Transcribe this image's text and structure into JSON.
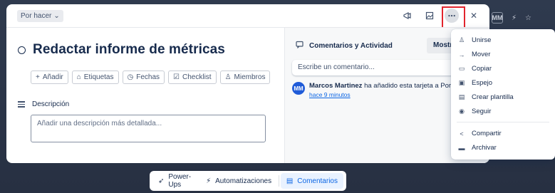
{
  "card": {
    "list_chip": "Por hacer",
    "title": "Redactar informe de métricas",
    "actions": [
      "Añadir",
      "Etiquetas",
      "Fechas",
      "Checklist",
      "Miembros"
    ],
    "description_heading": "Descripción",
    "description_placeholder": "Añadir una descripción más detallada..."
  },
  "activity_panel": {
    "heading": "Comentarios y Actividad",
    "show_button": "Mostrar",
    "comment_placeholder": "Escribe un comentario...",
    "entry": {
      "avatar_initials": "MM",
      "author": "Marcos Martinez",
      "text": "ha añadido esta tarjeta a Por hace",
      "time": "hace 9 minutos"
    }
  },
  "menu": {
    "items": [
      {
        "label": "Unirse",
        "icon": "user-plus-icon"
      },
      {
        "label": "Mover",
        "icon": "arrow-right-icon"
      },
      {
        "label": "Copiar",
        "icon": "copy-icon"
      },
      {
        "label": "Espejo",
        "icon": "mirror-icon"
      },
      {
        "label": "Crear plantilla",
        "icon": "template-icon"
      },
      {
        "label": "Seguir",
        "icon": "eye-icon"
      },
      {
        "label": "Compartir",
        "icon": "share-icon"
      },
      {
        "label": "Archivar",
        "icon": "archive-icon"
      }
    ]
  },
  "bottom_bar": {
    "items": [
      "Power-Ups",
      "Automatizaciones",
      "Comentarios"
    ]
  },
  "background": {
    "badge": "MM"
  },
  "colors": {
    "accent": "#0c66e4",
    "highlight_box": "#e2242d"
  }
}
